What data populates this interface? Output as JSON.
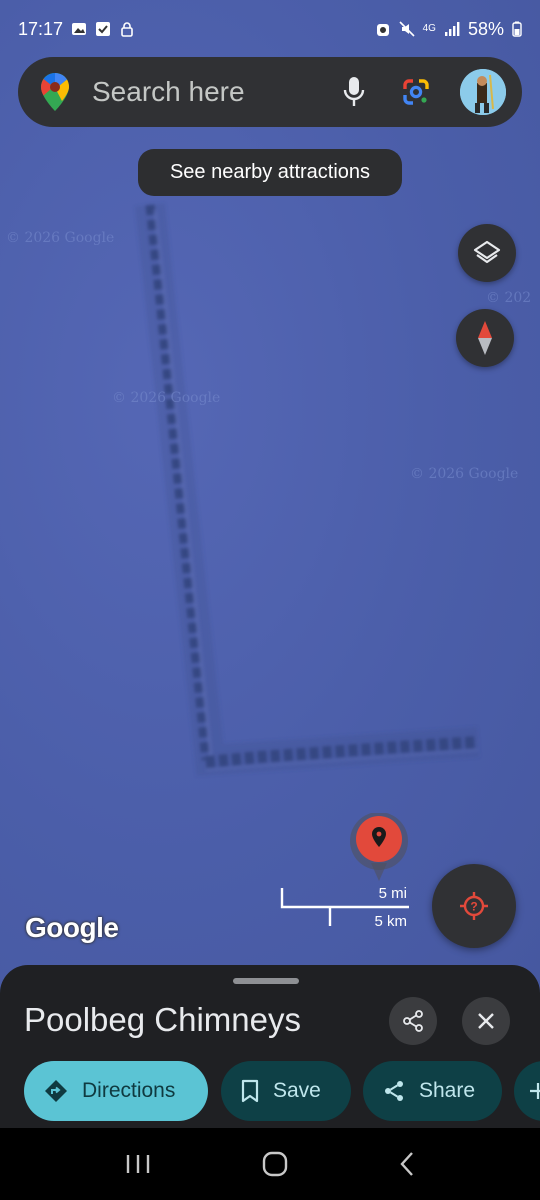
{
  "status_bar": {
    "time": "17:17",
    "network": "4G",
    "battery": "58%"
  },
  "search": {
    "placeholder": "Search here",
    "icons": [
      "maps-pin-icon",
      "microphone-icon",
      "google-lens-icon",
      "avatar"
    ]
  },
  "chip": {
    "label": "See nearby attractions"
  },
  "map": {
    "watermarks": [
      "© 2026 Google",
      "© 2026 Google",
      "© 2026 Google",
      "© 202"
    ],
    "scale_mi": "5 mi",
    "scale_km": "5 km",
    "logo": "Google"
  },
  "place": {
    "title": "Poolbeg Chimneys"
  },
  "actions": {
    "directions": "Directions",
    "save": "Save",
    "share": "Share"
  },
  "colors": {
    "map_water": "#4a5fa8",
    "sheet_bg": "#1f2023",
    "directions_bg": "#5bc4d4",
    "action_bg": "#0e4046",
    "pin_red": "#e2493b"
  }
}
